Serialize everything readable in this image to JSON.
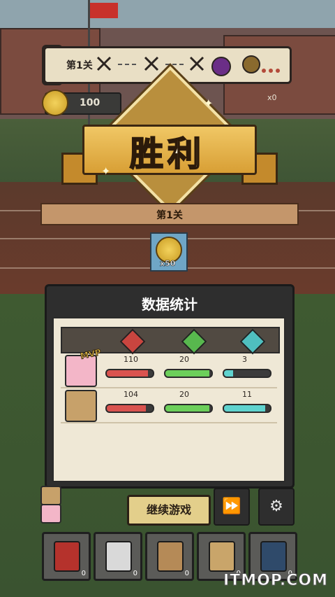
{
  "top": {
    "stage_label": "第1关",
    "coin_amount": "100",
    "enemy_count": "x0"
  },
  "victory": {
    "title": "胜利",
    "level": "第1关",
    "reward_count": "x50"
  },
  "stats": {
    "title": "数据统计",
    "rows": [
      {
        "badge": "MVP",
        "a": "110",
        "b": "20",
        "c": "3",
        "a_frac": 0.9,
        "b_frac": 0.95,
        "c_frac": 0.2
      },
      {
        "badge": "",
        "a": "104",
        "b": "20",
        "c": "11",
        "a_frac": 0.85,
        "b_frac": 0.95,
        "c_frac": 0.9
      }
    ]
  },
  "controls": {
    "continue_label": "继续游戏",
    "fast_forward_icon": "fast-forward-icon",
    "settings_icon": "gear-icon"
  },
  "inventory": [
    {
      "icon": "soda-can-icon",
      "count": "0"
    },
    {
      "icon": "first-aid-kit-icon",
      "count": "0"
    },
    {
      "icon": "map-scroll-icon",
      "count": "0"
    },
    {
      "icon": "paper-note-icon",
      "count": "0"
    },
    {
      "icon": "bomb-icon",
      "count": "0"
    }
  ],
  "watermark": "ITMOP.COM",
  "colors": {
    "red_bar": "#d9534f",
    "green_bar": "#6ccf5a",
    "cyan_bar": "#5fd3cf",
    "gold": "#e0b44a"
  }
}
